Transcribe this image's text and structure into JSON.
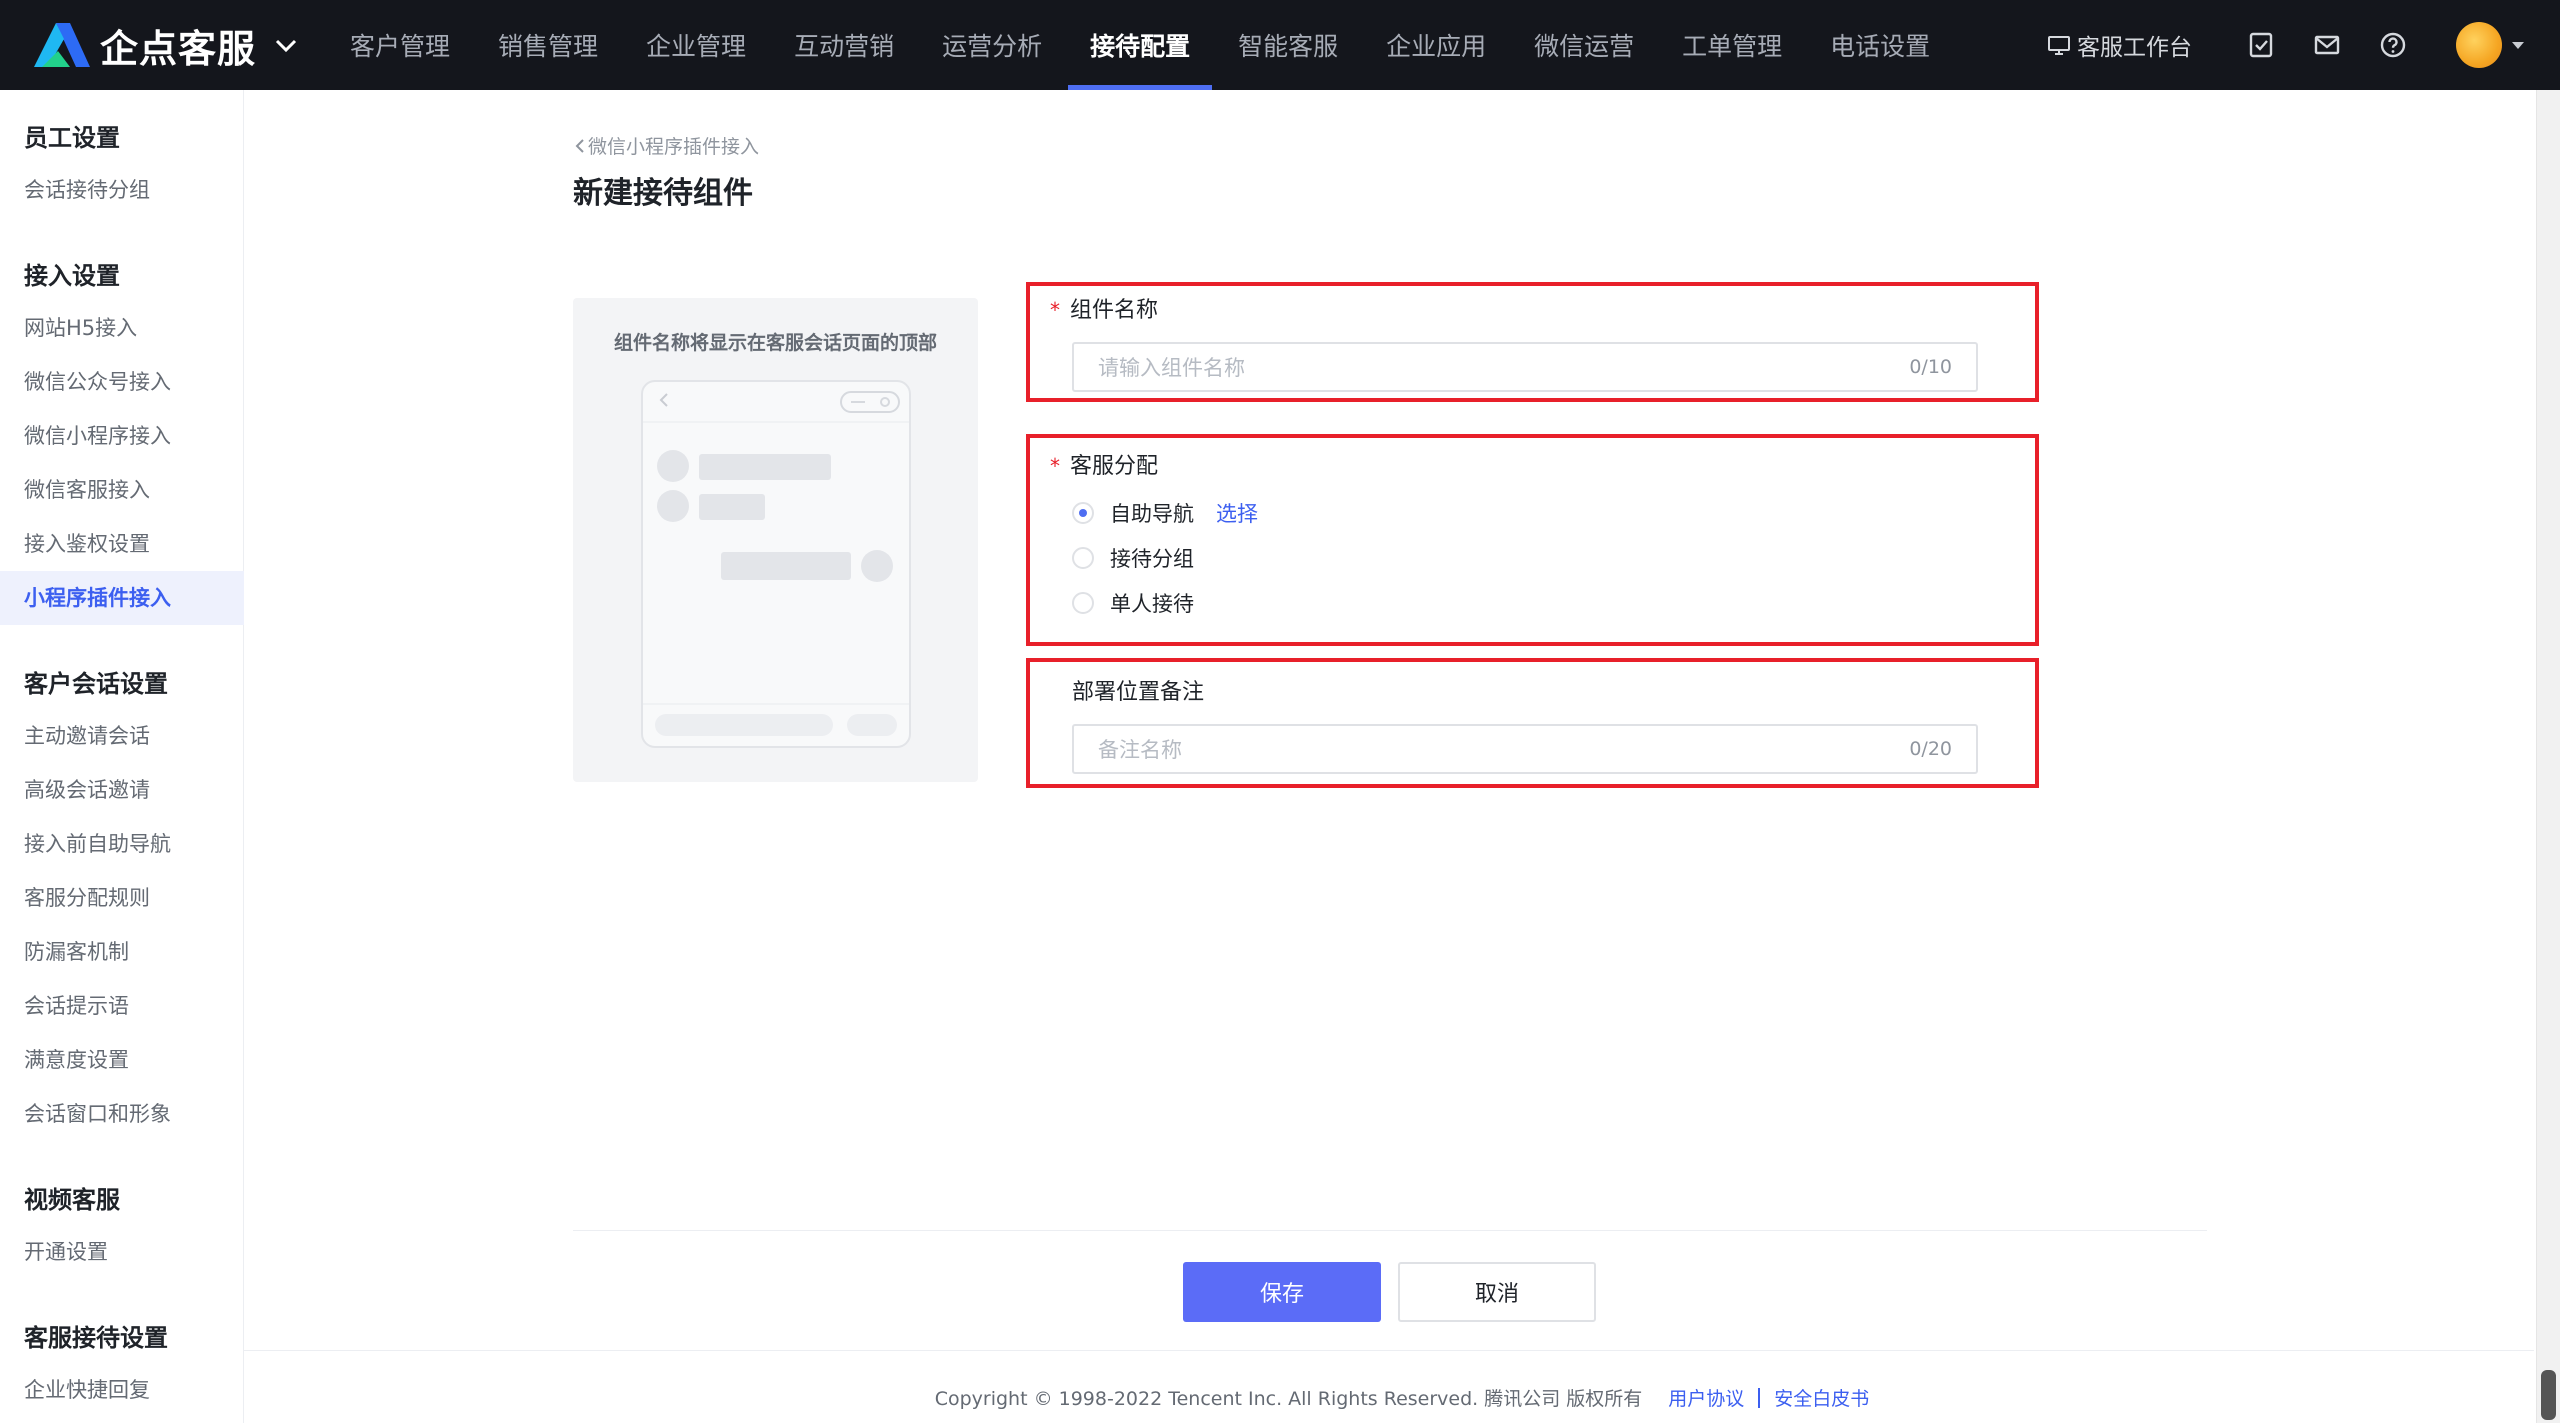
{
  "app": {
    "name": "企点客服",
    "workbench_label": "客服工作台"
  },
  "nav": {
    "items": [
      {
        "label": "客户管理",
        "active": false
      },
      {
        "label": "销售管理",
        "active": false
      },
      {
        "label": "企业管理",
        "active": false
      },
      {
        "label": "互动营销",
        "active": false
      },
      {
        "label": "运营分析",
        "active": false
      },
      {
        "label": "接待配置",
        "active": true
      },
      {
        "label": "智能客服",
        "active": false
      },
      {
        "label": "企业应用",
        "active": false
      },
      {
        "label": "微信运营",
        "active": false
      },
      {
        "label": "工单管理",
        "active": false
      },
      {
        "label": "电话设置",
        "active": false
      }
    ]
  },
  "sidebar": {
    "groups": [
      {
        "title": "员工设置",
        "items": [
          "会话接待分组"
        ]
      },
      {
        "title": "接入设置",
        "items": [
          "网站H5接入",
          "微信公众号接入",
          "微信小程序接入",
          "微信客服接入",
          "接入鉴权设置",
          "小程序插件接入"
        ]
      },
      {
        "title": "客户会话设置",
        "items": [
          "主动邀请会话",
          "高级会话邀请",
          "接入前自助导航",
          "客服分配规则",
          "防漏客机制",
          "会话提示语",
          "满意度设置",
          "会话窗口和形象"
        ]
      },
      {
        "title": "视频客服",
        "items": [
          "开通设置"
        ]
      },
      {
        "title": "客服接待设置",
        "items": [
          "企业快捷回复"
        ]
      }
    ],
    "active_item": "小程序插件接入"
  },
  "page": {
    "breadcrumb": "微信小程序插件接入",
    "title": "新建接待组件",
    "preview_caption": "组件名称将显示在客服会话页面的顶部"
  },
  "form": {
    "name_field": {
      "label": "组件名称",
      "required": true,
      "placeholder": "请输入组件名称",
      "count": "0/10"
    },
    "assign_field": {
      "label": "客服分配",
      "required": true,
      "options": [
        {
          "label": "自助导航",
          "checked": true,
          "link": "选择"
        },
        {
          "label": "接待分组",
          "checked": false
        },
        {
          "label": "单人接待",
          "checked": false
        }
      ]
    },
    "remark_field": {
      "label": "部署位置备注",
      "required": false,
      "placeholder": "备注名称",
      "count": "0/20"
    }
  },
  "actions": {
    "save_label": "保存",
    "cancel_label": "取消"
  },
  "footer": {
    "copyright": "Copyright © 1998-2022 Tencent Inc. All Rights Reserved. 腾讯公司 版权所有",
    "links": [
      "用户协议",
      "安全白皮书"
    ]
  },
  "colors": {
    "accent": "#4e6ef2",
    "highlight_box": "#e8202a",
    "topbar": "#14161c"
  }
}
